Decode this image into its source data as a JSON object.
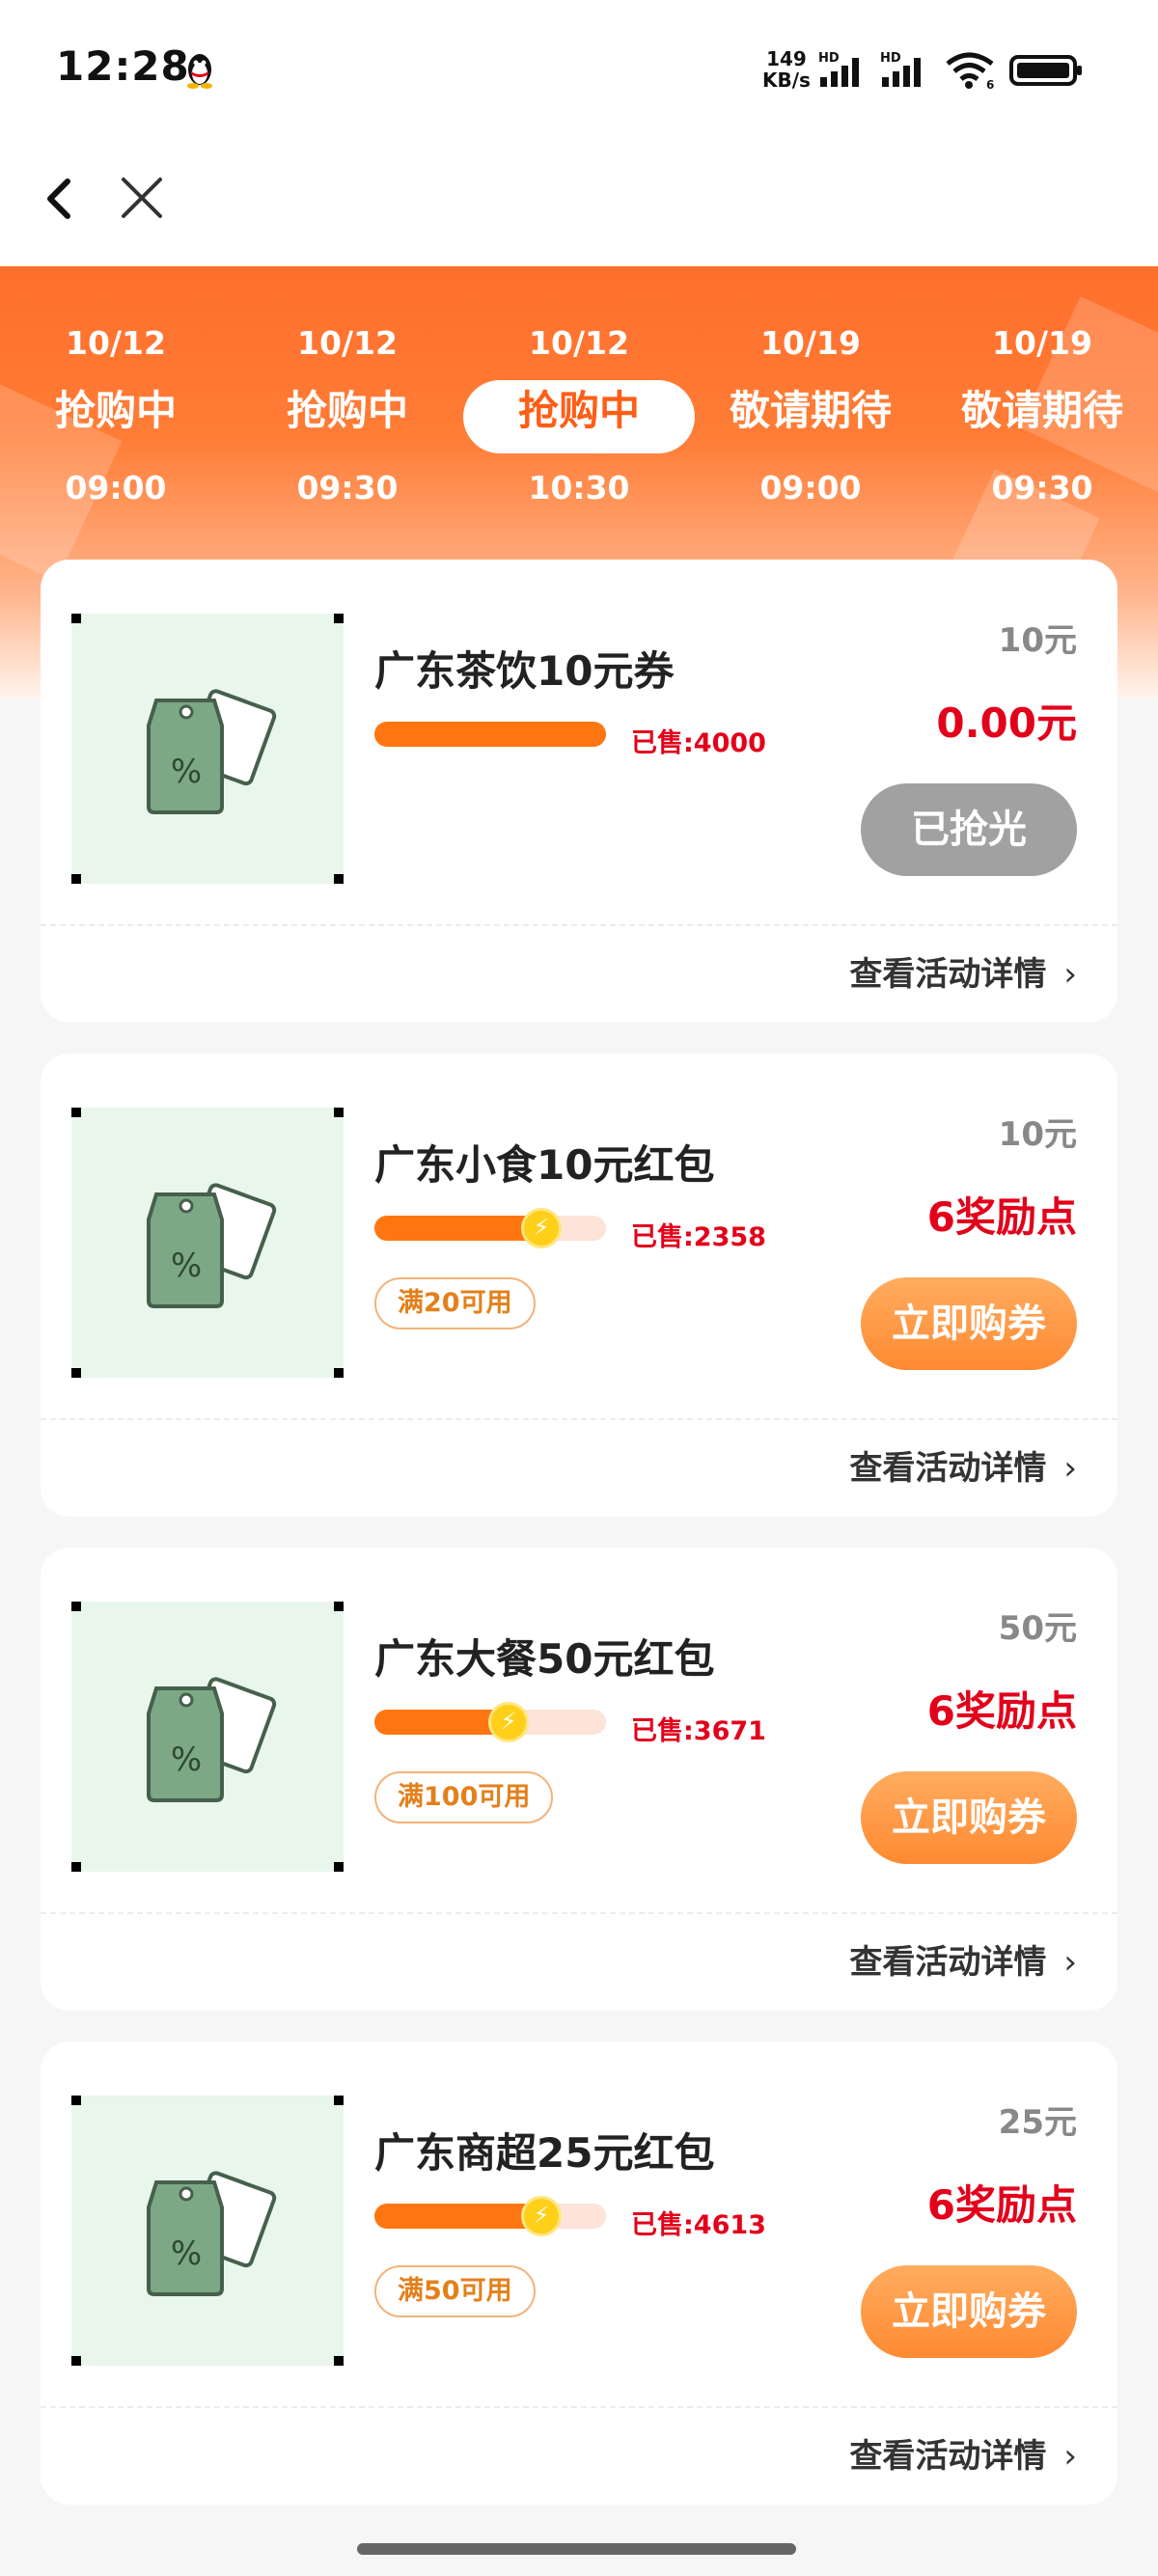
{
  "status_bar": {
    "time": "12:28",
    "net_speed_value": "149",
    "net_speed_unit": "KB/s",
    "signal_label": "HD",
    "wifi_label": "6"
  },
  "nav": {
    "back_icon": "chevron-left-icon",
    "close_icon": "close-icon"
  },
  "theme": {
    "primary": "#ff6e2c",
    "price_red": "#e3001b",
    "soldout_gray": "#a1a1a1"
  },
  "tabs": [
    {
      "date": "10/12",
      "status": "抢购中",
      "time": "09:00",
      "active": false
    },
    {
      "date": "10/12",
      "status": "抢购中",
      "time": "09:30",
      "active": false
    },
    {
      "date": "10/12",
      "status": "抢购中",
      "time": "10:30",
      "active": true
    },
    {
      "date": "10/19",
      "status": "敬请期待",
      "time": "09:00",
      "active": false
    },
    {
      "date": "10/19",
      "status": "敬请期待",
      "time": "09:30",
      "active": false
    }
  ],
  "items": [
    {
      "title": "广东茶饮10元券",
      "sold": "已售:4000",
      "progress": 1.0,
      "bolt": false,
      "condition": "",
      "face_value": "10元",
      "price": "0.00元",
      "button": "已抢光",
      "sold_out": true,
      "detail": "查看活动详情"
    },
    {
      "title": "广东小食10元红包",
      "sold": "已售:2358",
      "progress": 0.72,
      "bolt": true,
      "condition": "满20可用",
      "face_value": "10元",
      "price": "6奖励点",
      "button": "立即购券",
      "sold_out": false,
      "detail": "查看活动详情"
    },
    {
      "title": "广东大餐50元红包",
      "sold": "已售:3671",
      "progress": 0.58,
      "bolt": true,
      "condition": "满100可用",
      "face_value": "50元",
      "price": "6奖励点",
      "button": "立即购券",
      "sold_out": false,
      "detail": "查看活动详情"
    },
    {
      "title": "广东商超25元红包",
      "sold": "已售:4613",
      "progress": 0.72,
      "bolt": true,
      "condition": "满50可用",
      "face_value": "25元",
      "price": "6奖励点",
      "button": "立即购券",
      "sold_out": false,
      "detail": "查看活动详情"
    }
  ]
}
